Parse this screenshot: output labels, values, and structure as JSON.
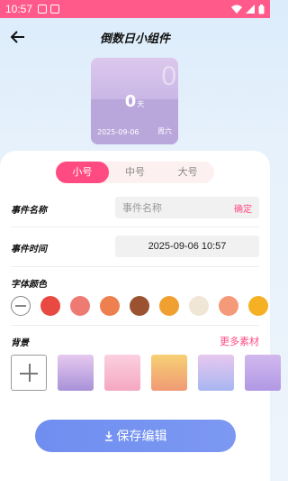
{
  "status_bar": {
    "time": "10:57"
  },
  "header": {
    "title": "倒数日小组件"
  },
  "preview": {
    "count": "0",
    "unit": "天",
    "big_digit": "0",
    "date": "2025-09-06",
    "weekday": "周六"
  },
  "size_tabs": [
    {
      "label": "小号",
      "active": true
    },
    {
      "label": "中号",
      "active": false
    },
    {
      "label": "大号",
      "active": false
    }
  ],
  "event_name": {
    "label": "事件名称",
    "placeholder": "事件名称",
    "value": "",
    "confirm": "确定"
  },
  "event_time": {
    "label": "事件时间",
    "value": "2025-09-06 10:57"
  },
  "font_color": {
    "label": "字体颜色",
    "colors": [
      "#e84a42",
      "#ee7a74",
      "#ee8050",
      "#9a5230",
      "#f0a030",
      "#efe6d6",
      "#f59a78",
      "#f6b024"
    ]
  },
  "background": {
    "label": "背景",
    "more": "更多素材",
    "swatches": [
      [
        "#e6c9ef",
        "#a892d8"
      ],
      [
        "#fbd0e0",
        "#f5a7c0"
      ],
      [
        "#f7d074",
        "#f09a74"
      ],
      [
        "#e8c8f0",
        "#a8b6f0"
      ],
      [
        "#d2b8ee",
        "#b098e4"
      ]
    ]
  },
  "save": {
    "label": "保存编辑"
  },
  "colors": {
    "accent": "#ff4b82",
    "save_button": "#7090f0"
  }
}
